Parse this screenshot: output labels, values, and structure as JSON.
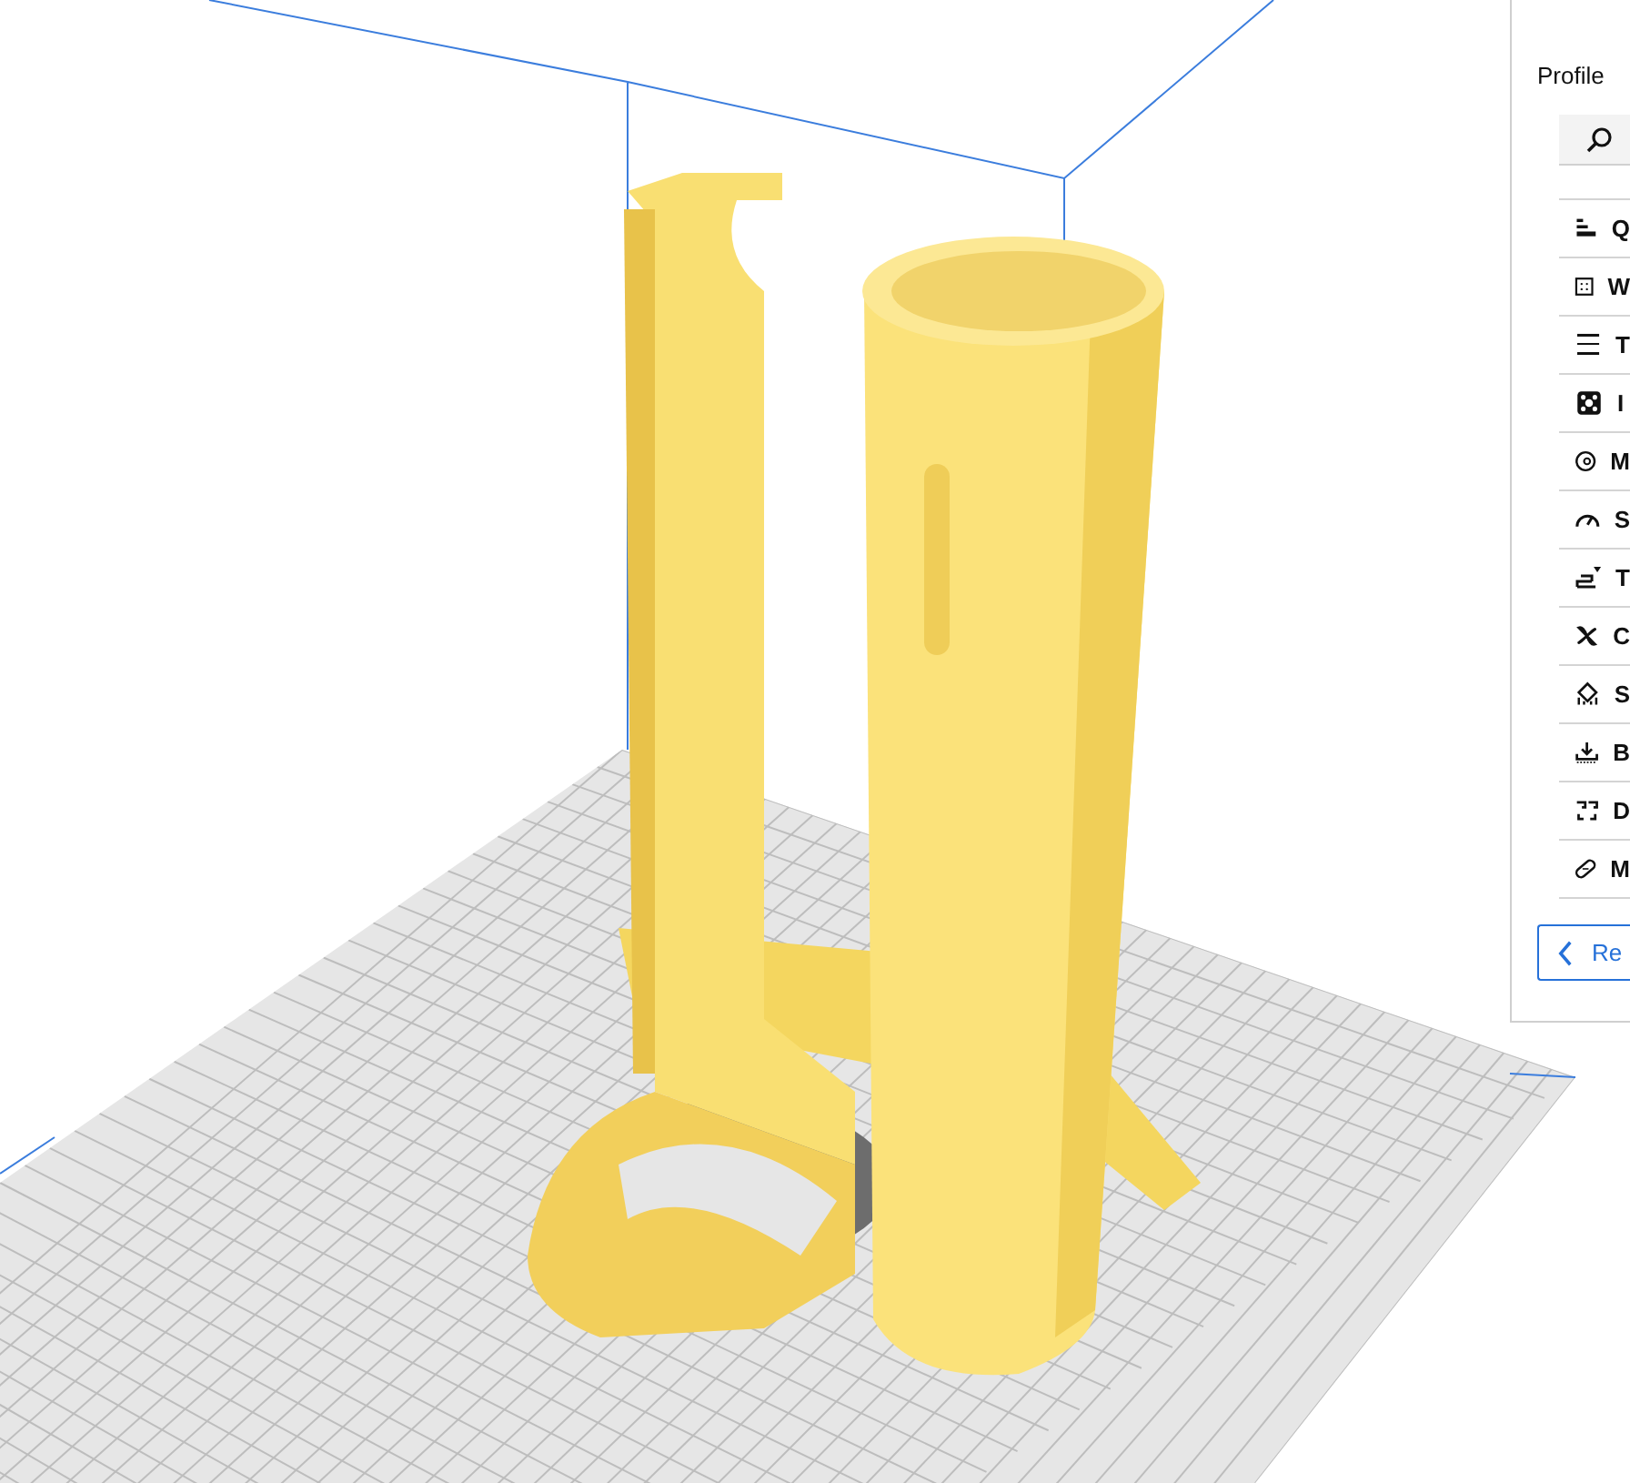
{
  "settings_panel": {
    "profile_label": "Profile",
    "categories": [
      {
        "label": "Q"
      },
      {
        "label": "W"
      },
      {
        "label": "T"
      },
      {
        "label": "I"
      },
      {
        "label": "M"
      },
      {
        "label": "S"
      },
      {
        "label": "T"
      },
      {
        "label": "C"
      },
      {
        "label": "S"
      },
      {
        "label": "B"
      },
      {
        "label": "D"
      },
      {
        "label": "M"
      }
    ],
    "recommended_button": "Re"
  }
}
